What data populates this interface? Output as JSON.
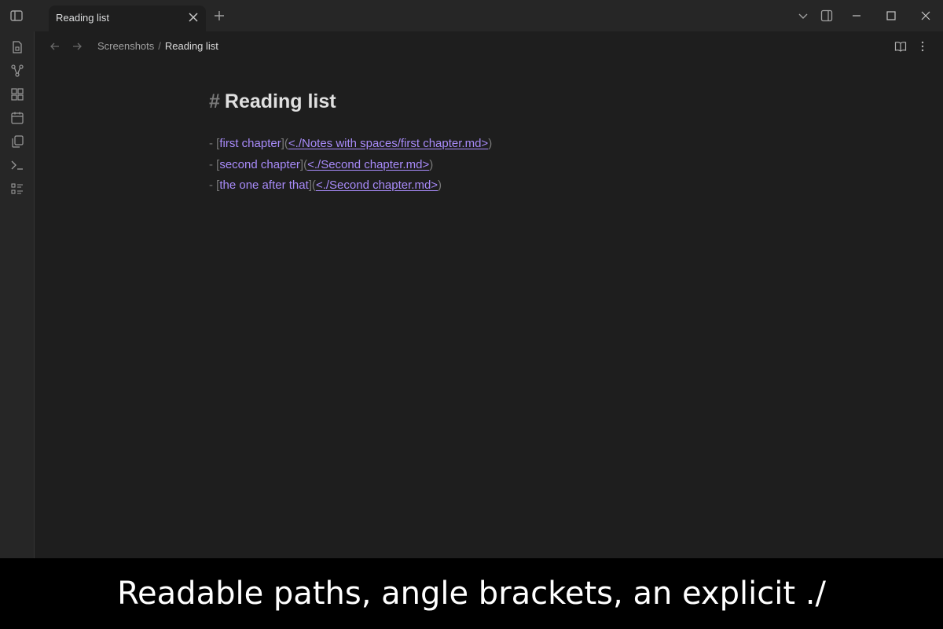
{
  "tab": {
    "title": "Reading list"
  },
  "breadcrumb": {
    "folder": "Screenshots",
    "separator": "/",
    "current": "Reading list"
  },
  "editor": {
    "heading_marker": "#",
    "heading": "Reading list",
    "items": [
      {
        "bullet": "-",
        "open_bracket": "[",
        "text": "first chapter",
        "mid": "](",
        "url": "<./Notes with spaces/first chapter.md>",
        "close": ")"
      },
      {
        "bullet": "-",
        "open_bracket": "[",
        "text": "second chapter",
        "mid": "](",
        "url": "<./Second chapter.md>",
        "close": ")"
      },
      {
        "bullet": "-",
        "open_bracket": "[",
        "text": "the one after that",
        "mid": "](",
        "url": "<./Second chapter.md>",
        "close": ")"
      }
    ]
  },
  "caption": {
    "text": "Readable paths, angle brackets, an explicit ./"
  },
  "colors": {
    "accent_link": "#a88bfa",
    "background": "#1e1e1e",
    "chrome": "#262626"
  },
  "icons": {
    "ribbon": [
      "file-icon",
      "graph-icon",
      "canvas-icon",
      "calendar-icon",
      "copy-icon",
      "terminal-icon",
      "list-icon"
    ],
    "window": [
      "chevron-down-icon",
      "right-sidebar-icon",
      "minimize-icon",
      "maximize-icon",
      "close-icon"
    ]
  }
}
